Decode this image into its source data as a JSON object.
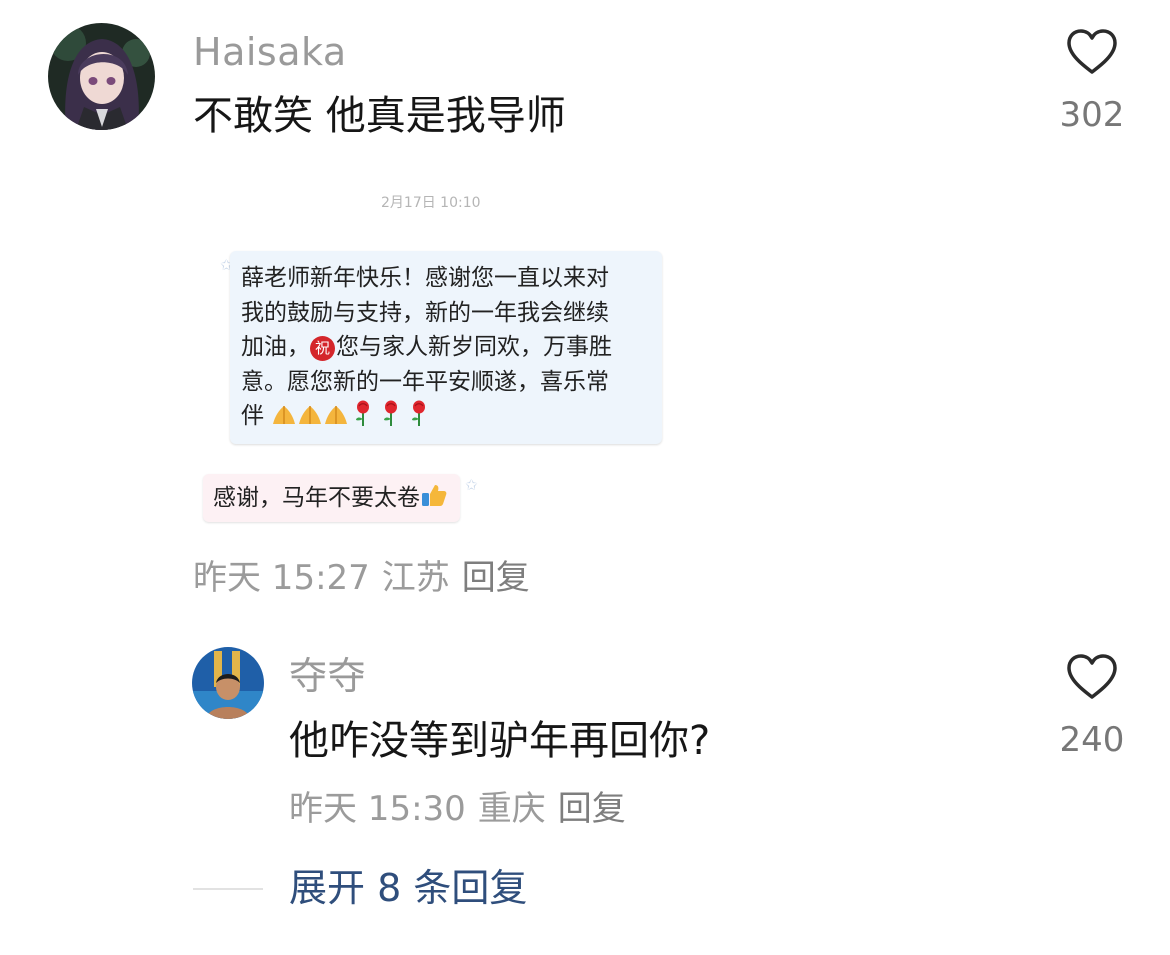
{
  "comment": {
    "username": "Haisaka",
    "text": "不敢笑 他真是我导师",
    "time": "昨天 15:27",
    "location": "江苏",
    "reply_label": "回复",
    "like_count": "302",
    "image": {
      "timestamp": "2月17日 10:10",
      "sent_lines": [
        "薛老师新年快乐！感谢您一直以来对",
        "我的鼓励与支持，新的一年我会继续"
      ],
      "sent_line3_before": "加油，",
      "bless_char": "祝",
      "sent_line3_after": "您与家人新岁同欢，万事胜",
      "sent_line4": "意。愿您新的一年平安顺遂，喜乐常",
      "sent_line5": "伴",
      "received_text": "感谢，马年不要太卷"
    }
  },
  "reply": {
    "username": "夺夺",
    "text": "他咋没等到驴年再回你?",
    "time": "昨天 15:30",
    "location": "重庆",
    "reply_label": "回复",
    "like_count": "240"
  },
  "expand_label": "展开 8 条回复",
  "colors": {
    "username": "#9a9a9a",
    "meta": "#9b9b9b",
    "link": "#2f4e7c",
    "sent_bubble": "#eef5fc",
    "received_bubble": "#fdf1f4"
  },
  "icons": [
    "heart-outline-icon",
    "praying-hands-emoji",
    "rose-emoji",
    "thumbs-up-emoji",
    "bless-badge-icon"
  ]
}
